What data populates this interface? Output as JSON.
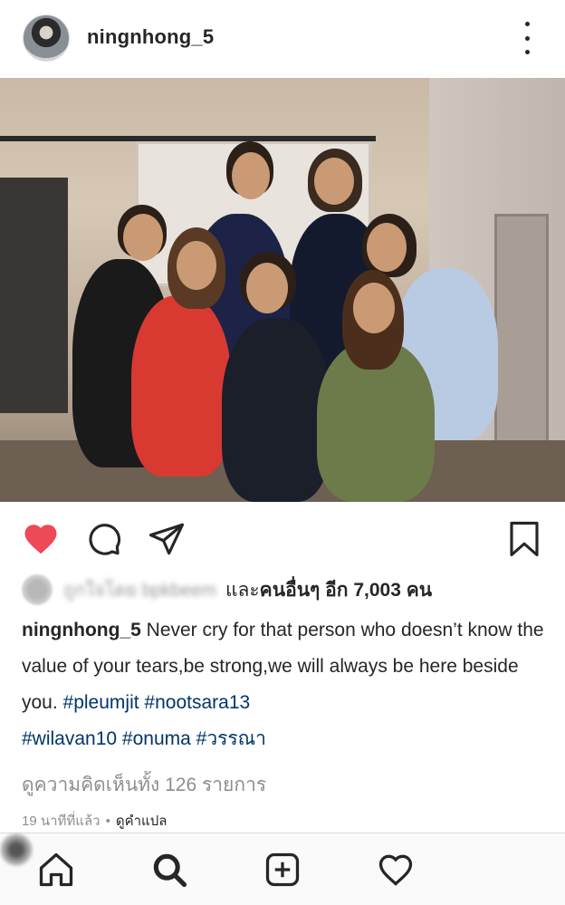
{
  "post": {
    "username": "ningnhong_5",
    "more_icon": "more-vertical-icon"
  },
  "actions": {
    "like_color": "#ed4956",
    "icons": [
      "heart-filled-icon",
      "comment-icon",
      "share-icon",
      "bookmark-icon"
    ]
  },
  "likes": {
    "liked_by_blurred": "ถูกใจโดย bpkbeem",
    "and": "และ",
    "others_label": "คนอื่นๆ อีก 7,003 คน"
  },
  "caption": {
    "username": "ningnhong_5",
    "text": " Never cry for that person who doesn’t know the value of your tears,be strong,we will always be here beside you. ",
    "tags": [
      "#pleumjit",
      "#nootsara13",
      "#wilavan10",
      "#onuma",
      "#วรรณา"
    ]
  },
  "comments": {
    "view_all": "ดูความคิดเห็นทั้ง 126 รายการ"
  },
  "meta": {
    "time": "19 นาทีที่แล้ว",
    "separator": "•",
    "translate": "ดูคำแปล"
  },
  "nav": {
    "items": [
      "home-icon",
      "search-icon",
      "add-post-icon",
      "activity-heart-icon",
      "profile-avatar"
    ]
  },
  "colors": {
    "accent_like": "#ed4956",
    "hashtag": "#003569",
    "muted": "#8e8e8e"
  }
}
